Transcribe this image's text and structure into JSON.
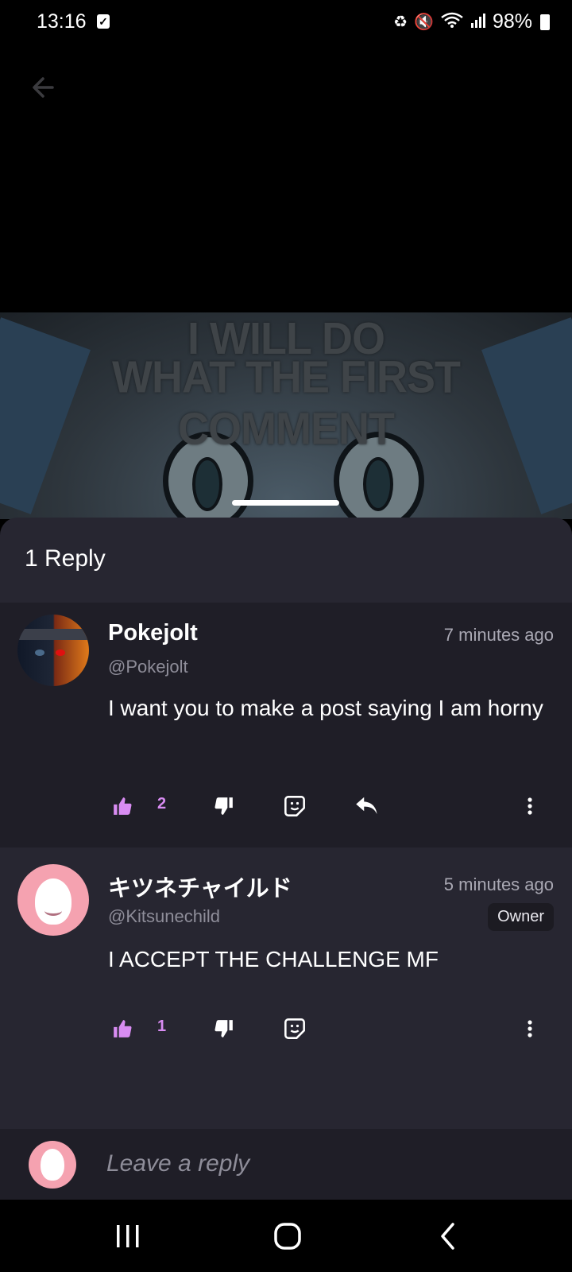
{
  "status_bar": {
    "time": "13:16",
    "battery": "98%"
  },
  "media": {
    "meme_line1": "I WILL DO",
    "meme_line2": "WHAT THE FIRST COMMENT"
  },
  "sheet": {
    "title": "1 Reply"
  },
  "comments": [
    {
      "author": "Pokejolt",
      "handle": "@Pokejolt",
      "time": "7 minutes ago",
      "body": "I want you to make a post saying I am horny",
      "likes": "2"
    },
    {
      "author": "キツネチャイルド",
      "handle": "@Kitsunechild",
      "time": "5 minutes ago",
      "badge": "Owner",
      "body": "I ACCEPT THE CHALLENGE MF",
      "likes": "1"
    }
  ],
  "reply_bar": {
    "placeholder": "Leave a reply"
  },
  "colors": {
    "accent": "#d88cf2",
    "sheet_bg": "#272631",
    "comment_bg": "#1f1e27"
  }
}
